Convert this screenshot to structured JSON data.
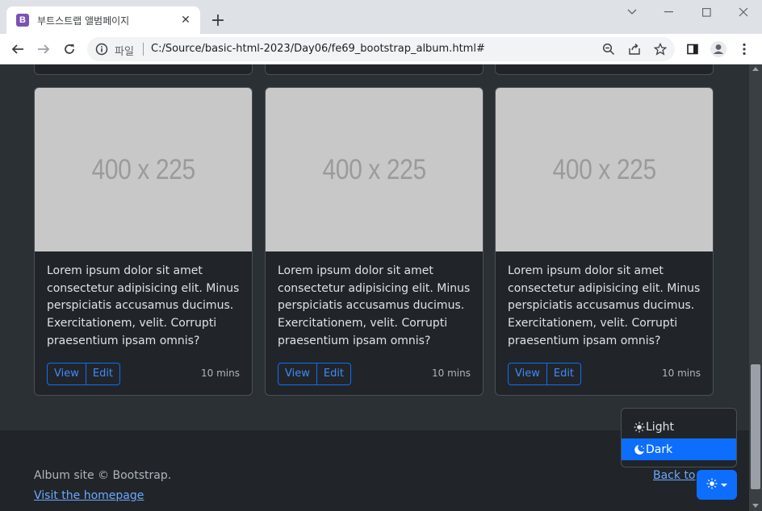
{
  "browser": {
    "tab_title": "부트스트랩 앨범페이지",
    "favicon_letter": "B",
    "new_tab": "+",
    "close_tab": "✕",
    "url_scheme_label": "파일",
    "url": "C:/Source/basic-html-2023/Day06/fe69_bootstrap_album.html#"
  },
  "cards": [
    {
      "thumb": "400 x 225",
      "text": "Lorem ipsum dolor sit amet consectetur adipisicing elit. Minus perspiciatis accusamus ducimus. Exercitationem, velit. Corrupti praesentium ipsam omnis?",
      "view": "View",
      "edit": "Edit",
      "time": "10 mins"
    },
    {
      "thumb": "400 x 225",
      "text": "Lorem ipsum dolor sit amet consectetur adipisicing elit. Minus perspiciatis accusamus ducimus. Exercitationem, velit. Corrupti praesentium ipsam omnis?",
      "view": "View",
      "edit": "Edit",
      "time": "10 mins"
    },
    {
      "thumb": "400 x 225",
      "text": "Lorem ipsum dolor sit amet consectetur adipisicing elit. Minus perspiciatis accusamus ducimus. Exercitationem, velit. Corrupti praesentium ipsam omnis?",
      "view": "View",
      "edit": "Edit",
      "time": "10 mins"
    }
  ],
  "footer": {
    "copyright": "Album site © Bootstrap.",
    "homepage_link": "Visit the homepage",
    "back_to_top": "Back to"
  },
  "theme_menu": {
    "light_label": "Light",
    "dark_label": "Dark",
    "selected": "Dark"
  },
  "colors": {
    "accent": "#0d6efd",
    "page_bg": "#2b3035",
    "card_bg": "#212529"
  }
}
